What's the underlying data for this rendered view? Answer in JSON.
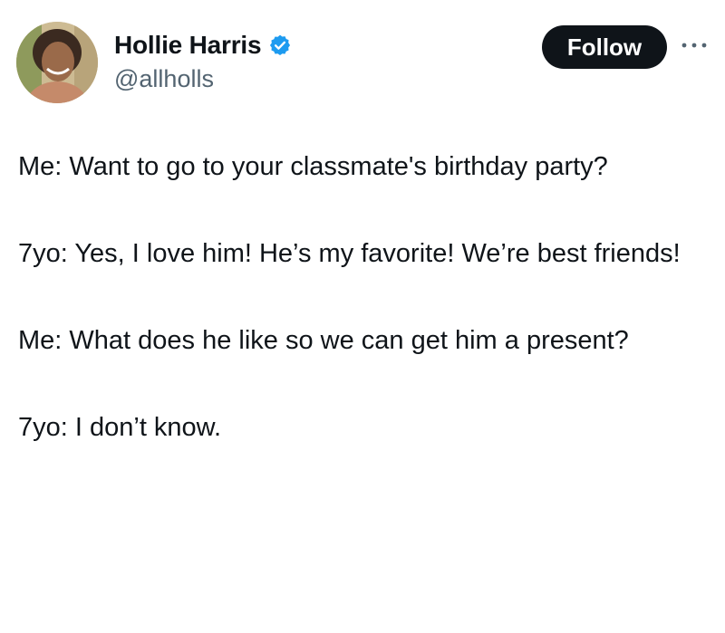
{
  "author": {
    "display_name": "Hollie Harris",
    "handle": "@allholls",
    "verified": true,
    "avatar_icon": "profile-photo"
  },
  "actions": {
    "follow_label": "Follow",
    "more_icon": "more-horizontal-icon"
  },
  "tweet": {
    "paragraphs": [
      "Me: Want to go to your classmate's birthday party?",
      "7yo: Yes, I love him! He’s my favorite! We’re best friends!",
      "Me: What does he like so we can get him a present?",
      "7yo: I don’t know."
    ]
  },
  "colors": {
    "text": "#0f1419",
    "secondary": "#536471",
    "verified_blue": "#1d9bf0",
    "button_bg": "#0f1419"
  }
}
